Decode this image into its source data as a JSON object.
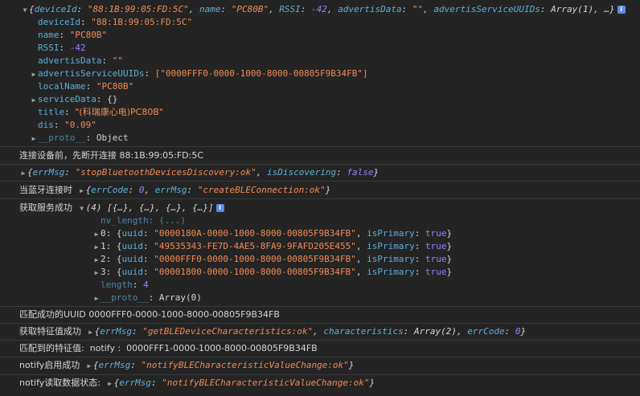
{
  "obj": {
    "summary": {
      "open": "{",
      "k1": "deviceId",
      "v1": "\"88:1B:99:05:FD:5C\"",
      "k2": "name",
      "v2": "\"PC80B\"",
      "k3": "RSSI",
      "v3": "-42",
      "k4": "advertisData",
      "v4": "\"\"",
      "k5": "advertisServiceUUIDs",
      "v5": "Array(1)",
      "tail": "…}"
    },
    "props": {
      "deviceId": "\"88:1B:99:05:FD:5C\"",
      "name": "\"PC80B\"",
      "RSSI": "-42",
      "advertisData": "\"\"",
      "advertisServiceUUIDs": "[\"0000FFF0-0000-1000-8000-00805F9B34FB\"]",
      "localName": "\"PC80B\"",
      "serviceData": "{}",
      "title": "\"(科瑞康心电)PC80B\"",
      "dis": "\"0.09\"",
      "proto_key": "__proto__",
      "proto_val": "Object"
    }
  },
  "logs": {
    "disconnect": "连接设备前，先断开连接 88:1B:99:05:FD:5C",
    "stop": {
      "k1": "errMsg",
      "v1": "\"stopBluetoothDevicesDiscovery:ok\"",
      "k2": "isDiscovering",
      "v2": "false"
    },
    "connected_label": "当蓝牙连接时",
    "connected": {
      "k1": "errCode",
      "v1": "0",
      "k2": "errMsg",
      "v2": "\"createBLEConnection:ok\""
    },
    "services_label": "获取服务成功",
    "services_summary": "(4) [{…}, {…}, {…}, {…}]",
    "nv_length": "nv_length: (...)",
    "services": [
      {
        "idx": "0",
        "uuid": "\"0000180A-0000-1000-8000-00805F9B34FB\"",
        "primary": "true"
      },
      {
        "idx": "1",
        "uuid": "\"49535343-FE7D-4AE5-8FA9-9FAFD205E455\"",
        "primary": "true"
      },
      {
        "idx": "2",
        "uuid": "\"0000FFF0-0000-1000-8000-00805F9B34FB\"",
        "primary": "true"
      },
      {
        "idx": "3",
        "uuid": "\"00001800-0000-1000-8000-00805F9B34FB\"",
        "primary": "true"
      }
    ],
    "length_key": "length",
    "length_val": "4",
    "services_proto": "Array(0)",
    "matched_uuid": "匹配成功的UUID 0000FFF0-0000-1000-8000-00805F9B34FB",
    "chars_label": "获取特征值成功",
    "chars": {
      "k1": "errMsg",
      "v1": "\"getBLEDeviceCharacteristics:ok\"",
      "k2": "characteristics",
      "v2": "Array(2)",
      "k3": "errCode",
      "v3": "0"
    },
    "matched_char": "匹配到的特征值:  notify :  0000FFF1-0000-1000-8000-00805F9B34FB",
    "notify_label": "notify启用成功",
    "notify": {
      "k1": "errMsg",
      "v1": "\"notifyBLECharacteristicValueChange:ok\""
    },
    "read_label": "notify读取数据状态:",
    "read": {
      "k1": "errMsg",
      "v1": "\"notifyBLECharacteristicValueChange:ok\""
    }
  },
  "ui": {
    "info_glyph": "i",
    "expand_glyph": "▶",
    "expanded_glyph": "▼"
  }
}
